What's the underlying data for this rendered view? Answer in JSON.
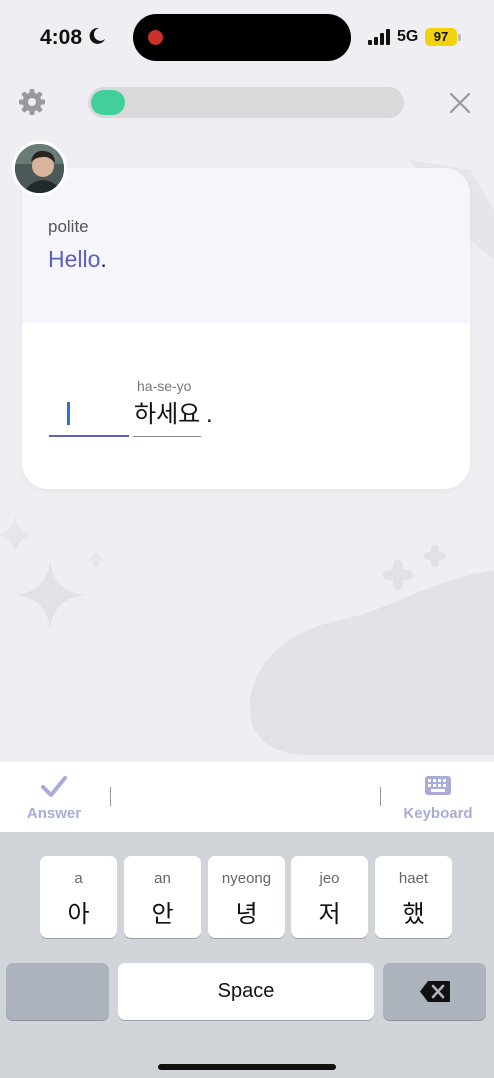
{
  "status_bar": {
    "time": "4:08",
    "network": "5G",
    "battery": "97"
  },
  "header": {
    "progress": 0.11,
    "settings_icon": "gear-icon",
    "close_icon": "close-icon"
  },
  "card": {
    "tag": "polite",
    "phrase": "Hello",
    "phrase_punct": ".",
    "romanization": "ha-se-yo",
    "korean_word": "하세요",
    "korean_punct": "."
  },
  "answer_bar": {
    "answer_label": "Answer",
    "keyboard_label": "Keyboard"
  },
  "keyboard": {
    "keys": [
      {
        "roman": "a",
        "hangul": "아"
      },
      {
        "roman": "an",
        "hangul": "안"
      },
      {
        "roman": "nyeong",
        "hangul": "녕"
      },
      {
        "roman": "jeo",
        "hangul": "저"
      },
      {
        "roman": "haet",
        "hangul": "했"
      }
    ],
    "space_label": "Space"
  },
  "colors": {
    "accent": "#5b5fc0",
    "progress_fill": "#41d09b",
    "answer_label": "#a9abd8"
  }
}
